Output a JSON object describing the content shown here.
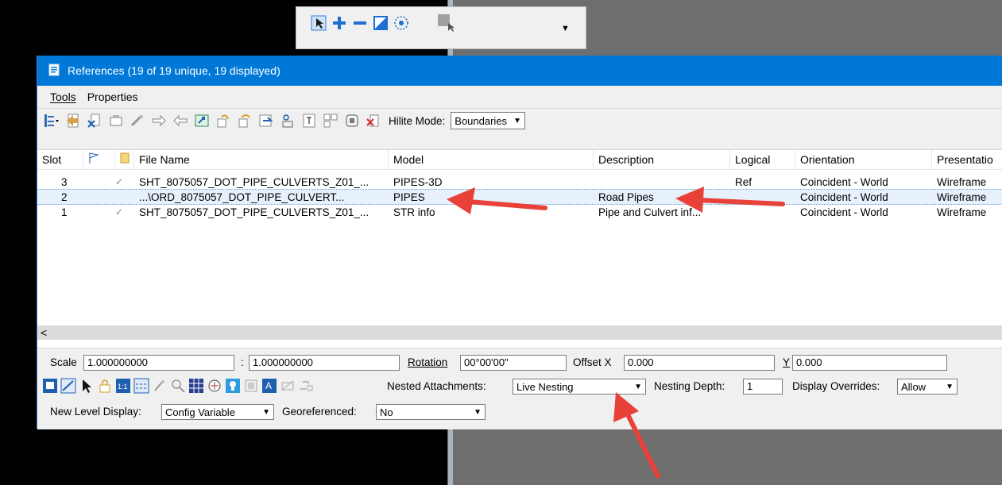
{
  "floating_toolbar": {
    "dropdown_glyph": "▼"
  },
  "window": {
    "title": "References (19 of 19 unique, 19 displayed)",
    "menu": [
      {
        "label": "Tools"
      },
      {
        "label": "Properties"
      }
    ],
    "toolbar": {
      "hilite_label": "Hilite Mode:",
      "hilite_value": "Boundaries"
    },
    "columns": [
      "Slot",
      "",
      "",
      "File Name",
      "Model",
      "Description",
      "Logical",
      "Orientation",
      "Presentatio"
    ],
    "rows": [
      {
        "slot": "3",
        "check": "✓",
        "file": "SHT_8075057_DOT_PIPE_CULVERTS_Z01_...",
        "model": "PIPES-3D",
        "description": "",
        "logical": "Ref",
        "orientation": "Coincident - World",
        "presentation": "Wireframe"
      },
      {
        "slot": "2",
        "check": "",
        "file": "...\\ORD_8075057_DOT_PIPE_CULVERT...",
        "model": "PIPES",
        "description": "Road Pipes",
        "logical": "",
        "orientation": "Coincident - World",
        "presentation": "Wireframe"
      },
      {
        "slot": "1",
        "check": "✓",
        "file": "SHT_8075057_DOT_PIPE_CULVERTS_Z01_...",
        "model": "STR info",
        "description": "Pipe and Culvert inf...",
        "logical": "",
        "orientation": "Coincident - World",
        "presentation": "Wireframe"
      }
    ],
    "scroll_left_glyph": "<",
    "settings": {
      "scale_label": "Scale",
      "scale_value": "1.000000000",
      "colon": ":",
      "scale_value2": "1.000000000",
      "rotation_label": "Rotation",
      "rotation_value": "00°00'00\"",
      "offset_x_label": "Offset X",
      "offset_x_value": "0.000",
      "y_label": "Y",
      "y_value": "0.000",
      "nested_label": "Nested Attachments:",
      "nested_value": "Live Nesting",
      "nesting_depth_label": "Nesting Depth:",
      "nesting_depth_value": "1",
      "display_overrides_label": "Display Overrides:",
      "display_overrides_value": "Allow",
      "new_level_label": "New Level Display:",
      "new_level_value": "Config Variable",
      "georeferenced_label": "Georeferenced:",
      "georeferenced_value": "No"
    }
  },
  "colors": {
    "titlebar": "#0078d7",
    "accent_arrow": "#e8413a",
    "selection": "#e6f1fb"
  }
}
